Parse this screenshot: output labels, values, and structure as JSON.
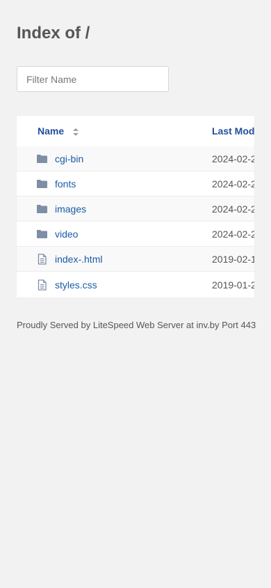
{
  "page": {
    "title": "Index of /"
  },
  "filter": {
    "placeholder": "Filter Name",
    "value": ""
  },
  "table": {
    "columns": {
      "name": "Name",
      "last_modified": "Last Mod"
    },
    "rows": [
      {
        "name": "cgi-bin",
        "type": "folder-icon",
        "modified": "2024-02-2"
      },
      {
        "name": "fonts",
        "type": "folder-icon",
        "modified": "2024-02-2"
      },
      {
        "name": "images",
        "type": "folder-icon",
        "modified": "2024-02-2"
      },
      {
        "name": "video",
        "type": "folder-icon",
        "modified": "2024-02-2"
      },
      {
        "name": "index-.html",
        "type": "file-icon",
        "modified": "2019-02-1"
      },
      {
        "name": "styles.css",
        "type": "file-icon",
        "modified": "2019-01-2"
      }
    ]
  },
  "footer": {
    "text": "Proudly Served by LiteSpeed Web Server at inv.by Port 443"
  },
  "colors": {
    "background": "#f2f2f2",
    "link": "#1a5aa6",
    "header_link": "#1f4f9a",
    "icon": "#7d8ea5"
  }
}
